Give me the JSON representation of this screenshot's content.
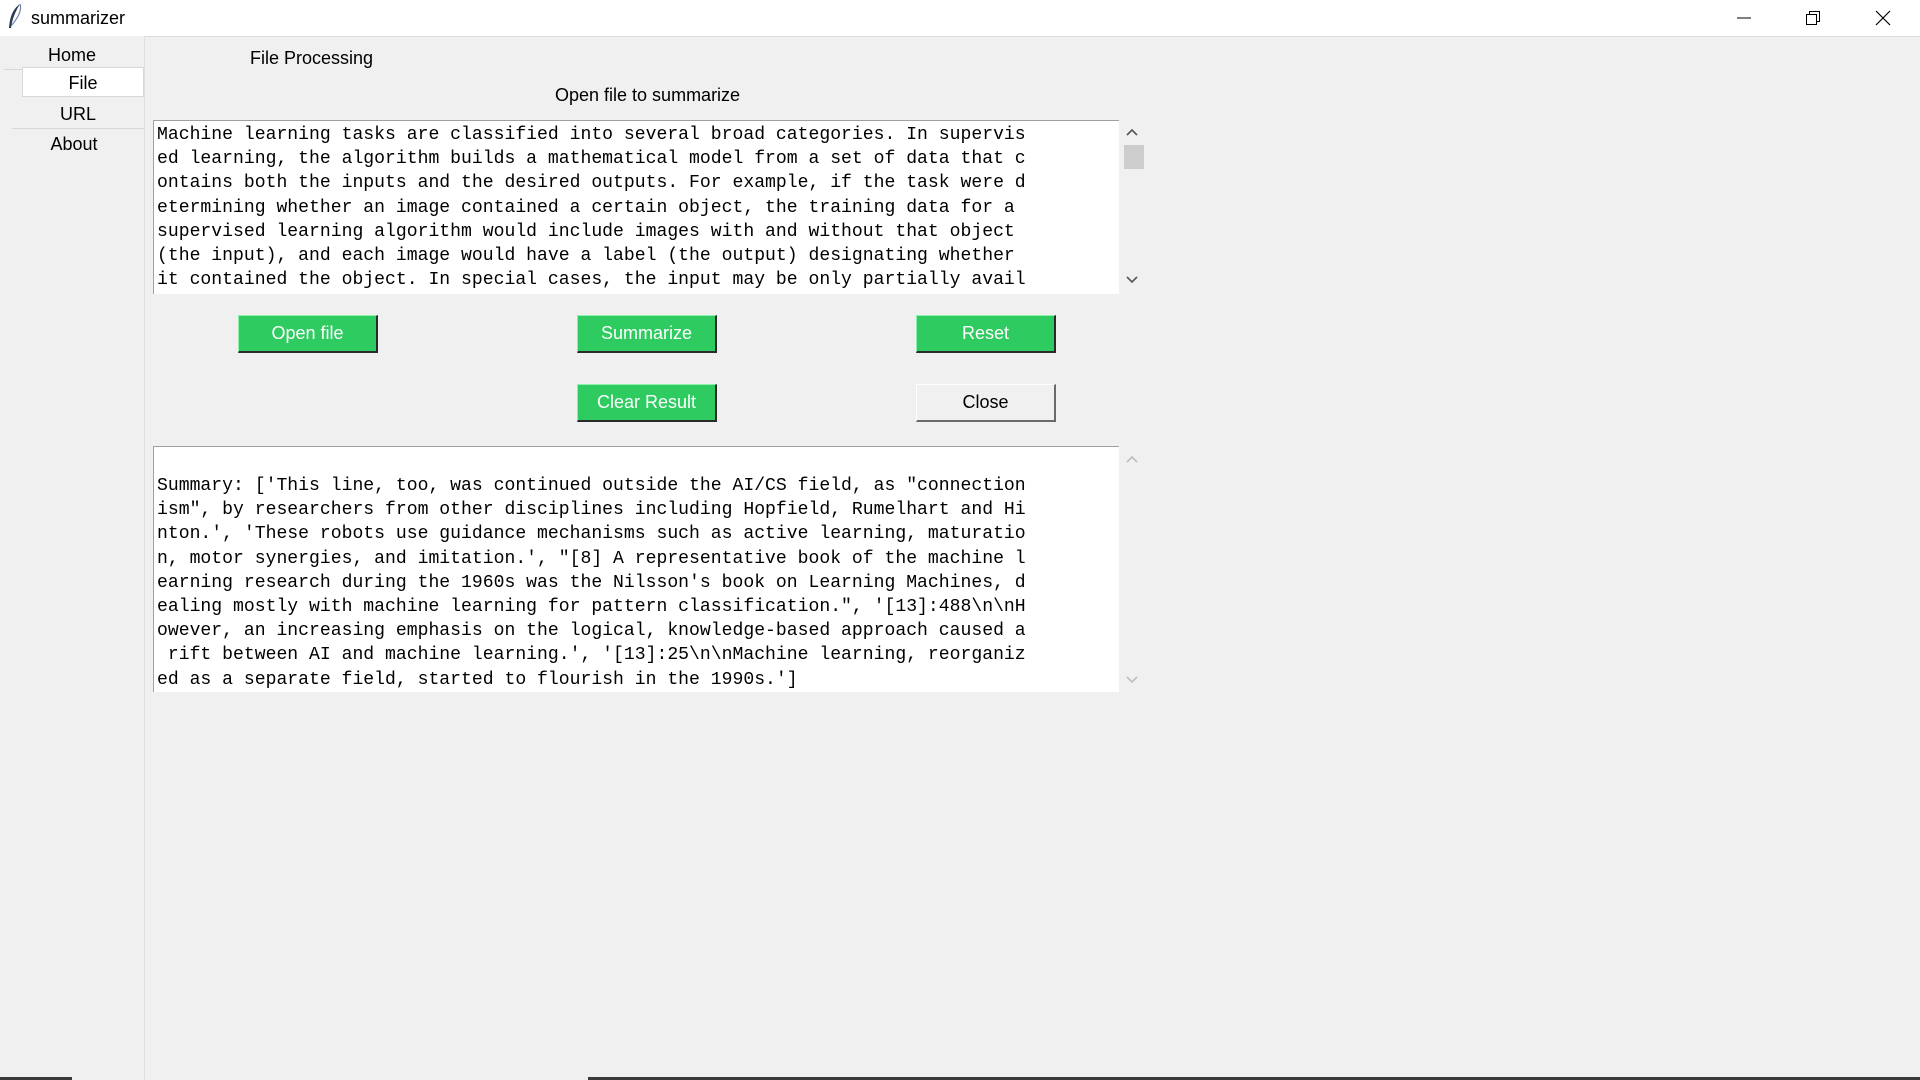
{
  "window": {
    "title": "summarizer",
    "minimize_icon": "minimize-icon",
    "restore_icon": "restore-icon",
    "close_icon": "close-icon",
    "app_icon": "feather-icon"
  },
  "sidebar": {
    "items": [
      {
        "label": "Home",
        "active": false
      },
      {
        "label": "File",
        "active": true
      },
      {
        "label": "URL",
        "active": false
      },
      {
        "label": "About",
        "active": false
      }
    ]
  },
  "main": {
    "section_title": "File Processing",
    "subtitle": "Open file to summarize",
    "input_text": "Machine learning tasks are classified into several broad categories. In supervis\ned learning, the algorithm builds a mathematical model from a set of data that c\nontains both the inputs and the desired outputs. For example, if the task were d\netermining whether an image contained a certain object, the training data for a \nsupervised learning algorithm would include images with and without that object \n(the input), and each image would have a label (the output) designating whether \nit contained the object. In special cases, the input may be only partially avail",
    "result_text": "Summary: ['This line, too, was continued outside the AI/CS field, as \"connection\nism\", by researchers from other disciplines including Hopfield, Rumelhart and Hi\nnton.', 'These robots use guidance mechanisms such as active learning, maturatio\nn, motor synergies, and imitation.', \"[8] A representative book of the machine l\nearning research during the 1960s was the Nilsson's book on Learning Machines, d\nealing mostly with machine learning for pattern classification.\", '[13]:488\\n\\nH\nowever, an increasing emphasis on the logical, knowledge-based approach caused a\n rift between AI and machine learning.', '[13]:25\\n\\nMachine learning, reorganiz\ned as a separate field, started to flourish in the 1990s.']"
  },
  "buttons": {
    "open_file": "Open file",
    "summarize": "Summarize",
    "reset": "Reset",
    "clear_result": "Clear Result",
    "close": "Close"
  },
  "colors": {
    "accent_green": "#2ecc60",
    "background": "#f0f0f0",
    "textbox_bg": "#ffffff"
  }
}
